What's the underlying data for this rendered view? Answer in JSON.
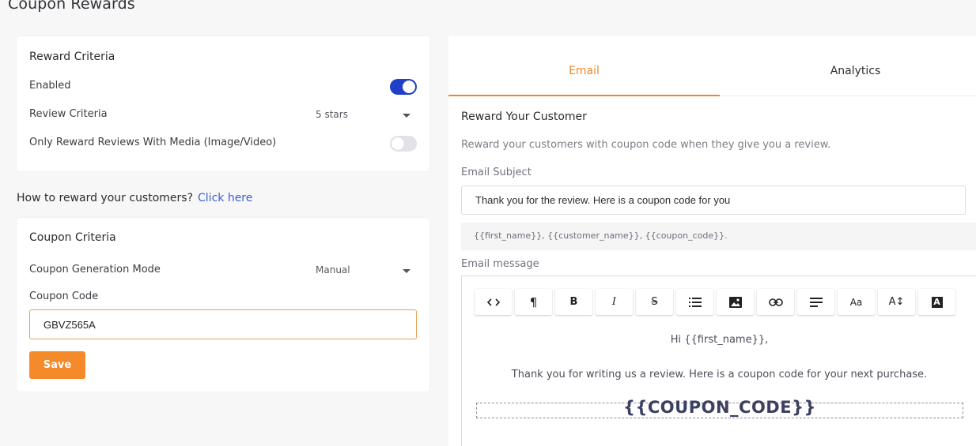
{
  "page": {
    "title": "Coupon Rewards"
  },
  "reward_criteria": {
    "title": "Reward Criteria",
    "enabled_label": "Enabled",
    "enabled": true,
    "review_criteria_label": "Review Criteria",
    "review_criteria_value": "5 stars",
    "media_only_label": "Only Reward Reviews With Media (Image/Video)",
    "media_only": false
  },
  "how_to": {
    "text": "How to reward your customers?",
    "link": "Click here"
  },
  "coupon_criteria": {
    "title": "Coupon Criteria",
    "mode_label": "Coupon Generation Mode",
    "mode_value": "Manual",
    "code_label": "Coupon Code",
    "code_value": "GBVZ565A",
    "save_label": "Save"
  },
  "tabs": [
    {
      "label": "Email",
      "active": true
    },
    {
      "label": "Analytics",
      "active": false
    }
  ],
  "email": {
    "section_title": "Reward Your Customer",
    "description": "Reward your customers with coupon code when they give you a review.",
    "subject_label": "Email Subject",
    "subject_value": "Thank you for the review. Here is a coupon code for you",
    "variables": "{{first_name}}, {{customer_name}}, {{coupon_code}}.",
    "message_label": "Email message",
    "toolbar": [
      {
        "name": "code-view-icon",
        "glyph": "<>"
      },
      {
        "name": "paragraph-icon",
        "glyph": "¶"
      },
      {
        "name": "bold-icon",
        "glyph": "B"
      },
      {
        "name": "italic-icon",
        "glyph": "I"
      },
      {
        "name": "strikethrough-icon",
        "glyph": "S"
      },
      {
        "name": "list-icon",
        "glyph": "list"
      },
      {
        "name": "image-icon",
        "glyph": "image"
      },
      {
        "name": "link-icon",
        "glyph": "link"
      },
      {
        "name": "align-icon",
        "glyph": "align"
      },
      {
        "name": "font-size-icon",
        "glyph": "Aa"
      },
      {
        "name": "line-height-icon",
        "glyph": "A↕"
      },
      {
        "name": "text-color-icon",
        "glyph": "A"
      }
    ],
    "message_greeting": "Hi {{first_name}},",
    "message_body": "Thank you for writing us a review. Here is a coupon code for your next purchase.",
    "message_coupon": "{{COUPON_CODE}}"
  },
  "colors": {
    "accent": "#f58a2a",
    "toggle_on": "#1f3ec9",
    "link": "#3a5fd0"
  }
}
